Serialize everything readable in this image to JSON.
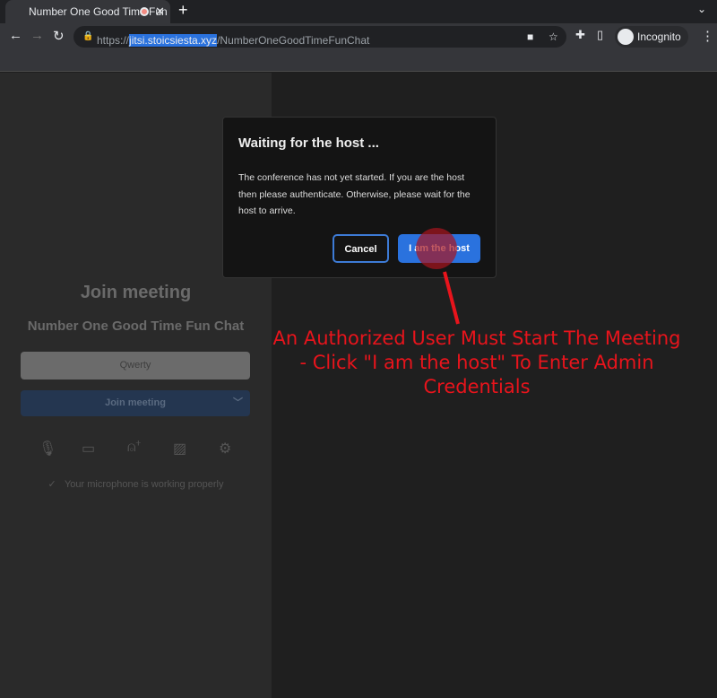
{
  "browser": {
    "tab_title": "Number One Good Time Fun Chat",
    "url_scheme": "https://",
    "url_host": "jitsi.stoicsiesta.xyz",
    "url_path": "/NumberOneGoodTimeFunChat",
    "profile": "Incognito"
  },
  "prejoin": {
    "title": "Join meeting",
    "meeting_name": "Number One Good Time Fun Chat",
    "name_value": "Qwerty",
    "join_label": "Join meeting",
    "mic_status": "Your microphone is working properly"
  },
  "dialog": {
    "title": "Waiting for the host ...",
    "body": "The conference has not yet started. If you are the host then please authenticate. Otherwise, please wait for the host to arrive.",
    "cancel": "Cancel",
    "host": "I am the host"
  },
  "annotation": {
    "text": "An Authorized User Must Start The Meeting - Click \"I am the host\" To Enter Admin Credentials",
    "color": "#e8141c"
  }
}
